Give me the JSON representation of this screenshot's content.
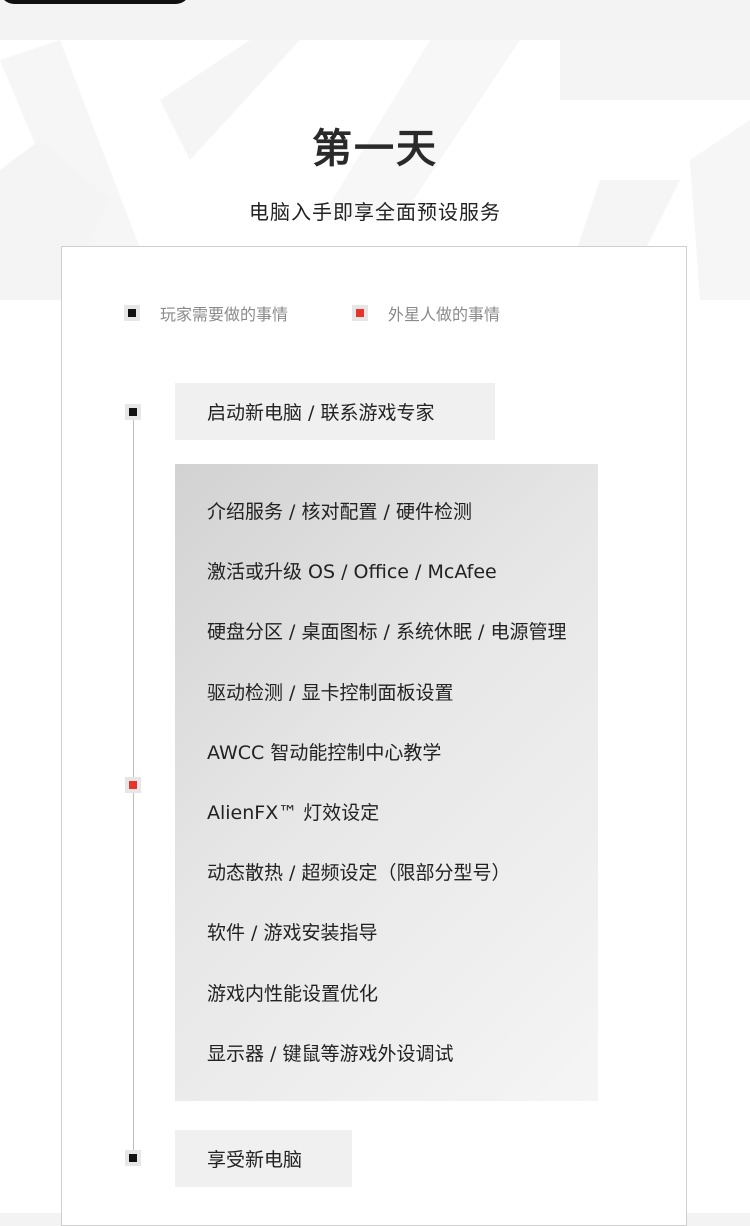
{
  "title": "第一天",
  "subtitle": "电脑入手即享全面预设服务",
  "legend": [
    {
      "label": "玩家需要做的事情",
      "color": "#111111"
    },
    {
      "label": "外星人做的事情",
      "color": "#e8332d"
    }
  ],
  "timeline": {
    "start": {
      "label": "启动新电脑 / 联系游戏专家"
    },
    "steps": [
      "介绍服务 / 核对配置 / 硬件检测",
      "激活或升级 OS / Office / McAfee",
      "硬盘分区 / 桌面图标 / 系统休眠 / 电源管理",
      "驱动检测 / 显卡控制面板设置",
      "AWCC 智动能控制中心教学",
      "AlienFX™ 灯效设定",
      "动态散热 / 超频设定（限部分型号）",
      "软件 / 游戏安装指导",
      "游戏内性能设置优化",
      "显示器 / 键鼠等游戏外设调试"
    ],
    "end": {
      "label": "享受新电脑"
    }
  },
  "colors": {
    "player": "#111111",
    "alien": "#e8332d",
    "line": "#bdbdbd",
    "marker_bg": "#e6e6e6"
  }
}
